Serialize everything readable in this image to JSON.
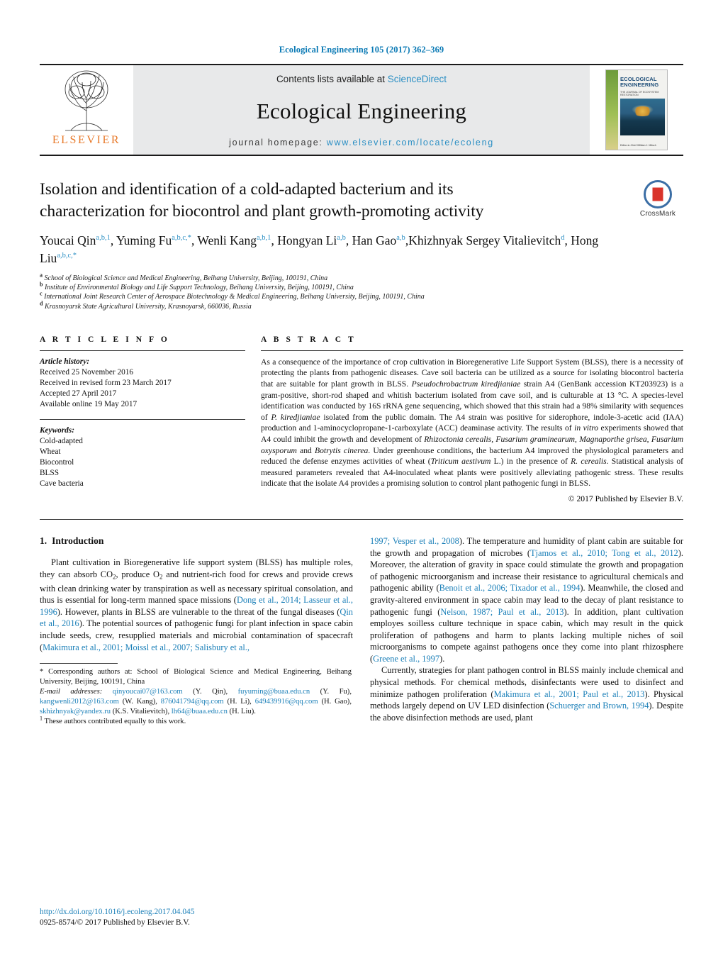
{
  "running_head": "Ecological Engineering 105 (2017) 362–369",
  "masthead": {
    "contents_prefix": "Contents lists available at ",
    "sciencedirect": "ScienceDirect",
    "journal_name": "Ecological Engineering",
    "homepage_prefix": "journal homepage: ",
    "homepage_url": "www.elsevier.com/locate/ecoleng",
    "publisher": "ELSEVIER",
    "cover": {
      "title": "ECOLOGICAL ENGINEERING",
      "subtitle": "THE JOURNAL OF ECOSYSTEM RESTORATION",
      "footer": "Editor-in-Chief\nWilliam J. Mitsch"
    }
  },
  "crossmark": {
    "label": "CrossMark"
  },
  "article": {
    "title": "Isolation and identification of a cold-adapted bacterium and its characterization for biocontrol and plant growth-promoting activity",
    "title_line1": "Isolation and identification of a cold-adapted bacterium and its",
    "title_line2": "characterization for biocontrol and plant growth-promoting activity",
    "authors": [
      {
        "name": "Youcai Qin",
        "marks": "a,b,1",
        "sep": ", "
      },
      {
        "name": "Yuming Fu",
        "marks": "a,b,c,",
        "star": "*",
        "sep": ", "
      },
      {
        "name": "Wenli Kang",
        "marks": "a,b,1",
        "sep": ", "
      },
      {
        "name": "Hongyan Li",
        "marks": "a,b",
        "sep": ", "
      },
      {
        "name": "Han Gao",
        "marks": "a,b",
        "sep": ","
      },
      {
        "name": "Khizhnyak Sergey Vitalievitch",
        "marks": "d",
        "sep": ", "
      },
      {
        "name": "Hong Liu",
        "marks": "a,b,c,",
        "star": "*",
        "sep": ""
      }
    ],
    "affiliations": [
      {
        "mark": "a",
        "text": "School of Biological Science and Medical Engineering, Beihang University, Beijing, 100191, China"
      },
      {
        "mark": "b",
        "text": "Institute of Environmental Biology and Life Support Technology, Beihang University, Beijing, 100191, China"
      },
      {
        "mark": "c",
        "text": "International Joint Research Center of Aerospace Biotechnology & Medical Engineering, Beihang University, Beijing, 100191, China"
      },
      {
        "mark": "d",
        "text": "Krasnoyarsk State Agricultural University, Krasnoyarsk, 660036, Russia"
      }
    ]
  },
  "article_info": {
    "heading": "A R T I C L E   I N F O",
    "history_label": "Article history:",
    "history": [
      "Received 25 November 2016",
      "Received in revised form 23 March 2017",
      "Accepted 27 April 2017",
      "Available online 19 May 2017"
    ],
    "keywords_label": "Keywords:",
    "keywords": [
      "Cold-adapted",
      "Wheat",
      "Biocontrol",
      "BLSS",
      "Cave bacteria"
    ]
  },
  "abstract": {
    "heading": "A B S T R A C T",
    "paragraph_parts": [
      {
        "t": "As a consequence of the importance of crop cultivation in Bioregenerative Life Support System (BLSS), there is a necessity of protecting the plants from pathogenic diseases. Cave soil bacteria can be utilized as a source for isolating biocontrol bacteria that are suitable for plant growth in BLSS. ",
        "i": false
      },
      {
        "t": "Pseudochrobactrum kiredjianiae",
        "i": true
      },
      {
        "t": " strain A4 (GenBank accession KT203923) is a gram-positive, short-rod shaped and whitish bacterium isolated from cave soil, and is culturable at 13 °C. A species-level identification was conducted by 16S rRNA gene sequencing, which showed that this strain had a 98% similarity with sequences of ",
        "i": false
      },
      {
        "t": "P. kiredjianiae",
        "i": true
      },
      {
        "t": " isolated from the public domain. The A4 strain was positive for siderophore, indole-3-acetic acid (IAA) production and 1-aminocyclopropane-1-carboxylate (ACC) deaminase activity. The results of ",
        "i": false
      },
      {
        "t": "in vitro",
        "i": true
      },
      {
        "t": " experiments showed that A4 could inhibit the growth and development of ",
        "i": false
      },
      {
        "t": "Rhizoctonia cerealis, Fusarium graminearum, Magnaporthe grisea, Fusarium oxysporum",
        "i": true
      },
      {
        "t": " and ",
        "i": false
      },
      {
        "t": "Botrytis cinerea",
        "i": true
      },
      {
        "t": ". Under greenhouse conditions, the bacterium A4 improved the physiological parameters and reduced the defense enzymes activities of wheat (",
        "i": false
      },
      {
        "t": "Triticum aestivum",
        "i": true
      },
      {
        "t": " L.) in the presence of ",
        "i": false
      },
      {
        "t": "R. cerealis",
        "i": true
      },
      {
        "t": ". Statistical analysis of measured parameters revealed that A4-inoculated wheat plants were positively alleviating pathogenic stress. These results indicate that the isolate A4 provides a promising solution to control plant pathogenic fungi in BLSS.",
        "i": false
      }
    ],
    "copyright": "© 2017 Published by Elsevier B.V."
  },
  "introduction": {
    "number": "1.",
    "title": "Introduction",
    "left_paragraph_parts": [
      {
        "t": "Plant cultivation in Bioregenerative life support system (BLSS) has multiple roles, they can absorb CO",
        "k": "n"
      },
      {
        "t": "2",
        "k": "sub"
      },
      {
        "t": ", produce O",
        "k": "n"
      },
      {
        "t": "2",
        "k": "sub"
      },
      {
        "t": " and nutrient-rich food for crews and provide crews with clean drinking water by transpiration as well as necessary spiritual consolation, and thus is essential for long-term manned space missions (",
        "k": "n"
      },
      {
        "t": "Dong et al., 2014; Lasseur et al., 1996",
        "k": "ref"
      },
      {
        "t": "). However, plants in BLSS are vulnerable to the threat of the fungal diseases (",
        "k": "n"
      },
      {
        "t": "Qin et al., 2016",
        "k": "ref"
      },
      {
        "t": "). The potential sources of pathogenic fungi for plant infection in space cabin include seeds, crew, resupplied materials and microbial contamination of spacecraft (",
        "k": "n"
      },
      {
        "t": "Makimura et al., 2001; Moissl et al., 2007; Salisbury et al.,",
        "k": "ref"
      }
    ],
    "right_paragraph1_parts": [
      {
        "t": "1997; Vesper et al., 2008",
        "k": "ref"
      },
      {
        "t": "). The temperature and humidity of plant cabin are suitable for the growth and propagation of microbes (",
        "k": "n"
      },
      {
        "t": "Tjamos et al., 2010; Tong et al., 2012",
        "k": "ref"
      },
      {
        "t": "). Moreover, the alteration of gravity in space could stimulate the growth and propagation of pathogenic microorganism and increase their resistance to agricultural chemicals and pathogenic ability (",
        "k": "n"
      },
      {
        "t": "Benoit et al., 2006; Tixador et al., 1994",
        "k": "ref"
      },
      {
        "t": "). Meanwhile, the closed and gravity-altered environment in space cabin may lead to the decay of plant resistance to pathogenic fungi (",
        "k": "n"
      },
      {
        "t": "Nelson, 1987; Paul et al., 2013",
        "k": "ref"
      },
      {
        "t": "). In addition, plant cultivation employes soilless culture technique in space cabin, which may result in the quick proliferation of pathogens and harm to plants lacking multiple niches of soil microorganisms to compete against pathogens once they come into plant rhizosphere (",
        "k": "n"
      },
      {
        "t": "Greene et al., 1997",
        "k": "ref"
      },
      {
        "t": ").",
        "k": "n"
      }
    ],
    "right_paragraph2_parts": [
      {
        "t": "Currently, strategies for plant pathogen control in BLSS mainly include chemical and physical methods. For chemical methods, disinfectants were used to disinfect and minimize pathogen proliferation (",
        "k": "n"
      },
      {
        "t": "Makimura et al., 2001; Paul et al., 2013",
        "k": "ref"
      },
      {
        "t": "). Physical methods largely depend on UV LED disinfection (",
        "k": "n"
      },
      {
        "t": "Schuerger and Brown, 1994",
        "k": "ref"
      },
      {
        "t": "). Despite the above disinfection methods are used, plant",
        "k": "n"
      }
    ]
  },
  "footnotes": {
    "corresponding": "* Corresponding authors at: School of Biological Science and Medical Engineering, Beihang University, Beijing, 100191, China",
    "email_label": "E-mail addresses:",
    "emails": [
      {
        "addr": "qinyoucai07@163.com",
        "who": "(Y. Qin),"
      },
      {
        "addr": "fuyuming@buaa.edu.cn",
        "who": "(Y. Fu),"
      },
      {
        "addr": "kangwenli2012@163.com",
        "who": "(W. Kang),"
      },
      {
        "addr": "876041794@qq.com",
        "who": "(H. Li),"
      },
      {
        "addr": "649439916@qq.com",
        "who": "(H. Gao),"
      },
      {
        "addr": "skhizhnyak@yandex.ru",
        "who": "(K.S. Vitalievitch),"
      },
      {
        "addr": "lh64@buaa.edu.cn",
        "who": "(H. Liu)."
      }
    ],
    "equal_contrib_mark": "1",
    "equal_contrib": "These authors contributed equally to this work."
  },
  "footer": {
    "doi": "http://dx.doi.org/10.1016/j.ecoleng.2017.04.045",
    "issn": "0925-8574/© 2017 Published by Elsevier B.V."
  },
  "colors": {
    "link_blue": "#1a7fb8",
    "header_blue": "#0b7ab5",
    "elsevier_orange": "#e87a2b",
    "masthead_grey": "#e8e9ea"
  }
}
